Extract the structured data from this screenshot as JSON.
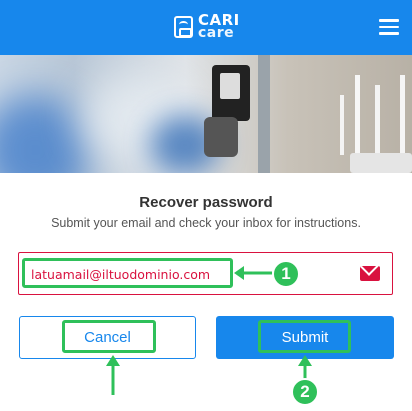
{
  "header": {
    "brand_line1": "CARI",
    "brand_line2": "care",
    "menu_icon": "hamburger-icon"
  },
  "hero": {
    "description_icon": "hero-image"
  },
  "form": {
    "title": "Recover password",
    "subtitle": "Submit your email and check your inbox for instructions.",
    "email_value": "latuamail@iltuodominio.com",
    "email_icon": "envelope-icon",
    "cancel_label": "Cancel",
    "submit_label": "Submit"
  },
  "annotations": {
    "step1": "1",
    "step2": "2"
  },
  "colors": {
    "primary": "#1787ec",
    "error": "#d9123f",
    "highlight": "#2fc05a"
  }
}
